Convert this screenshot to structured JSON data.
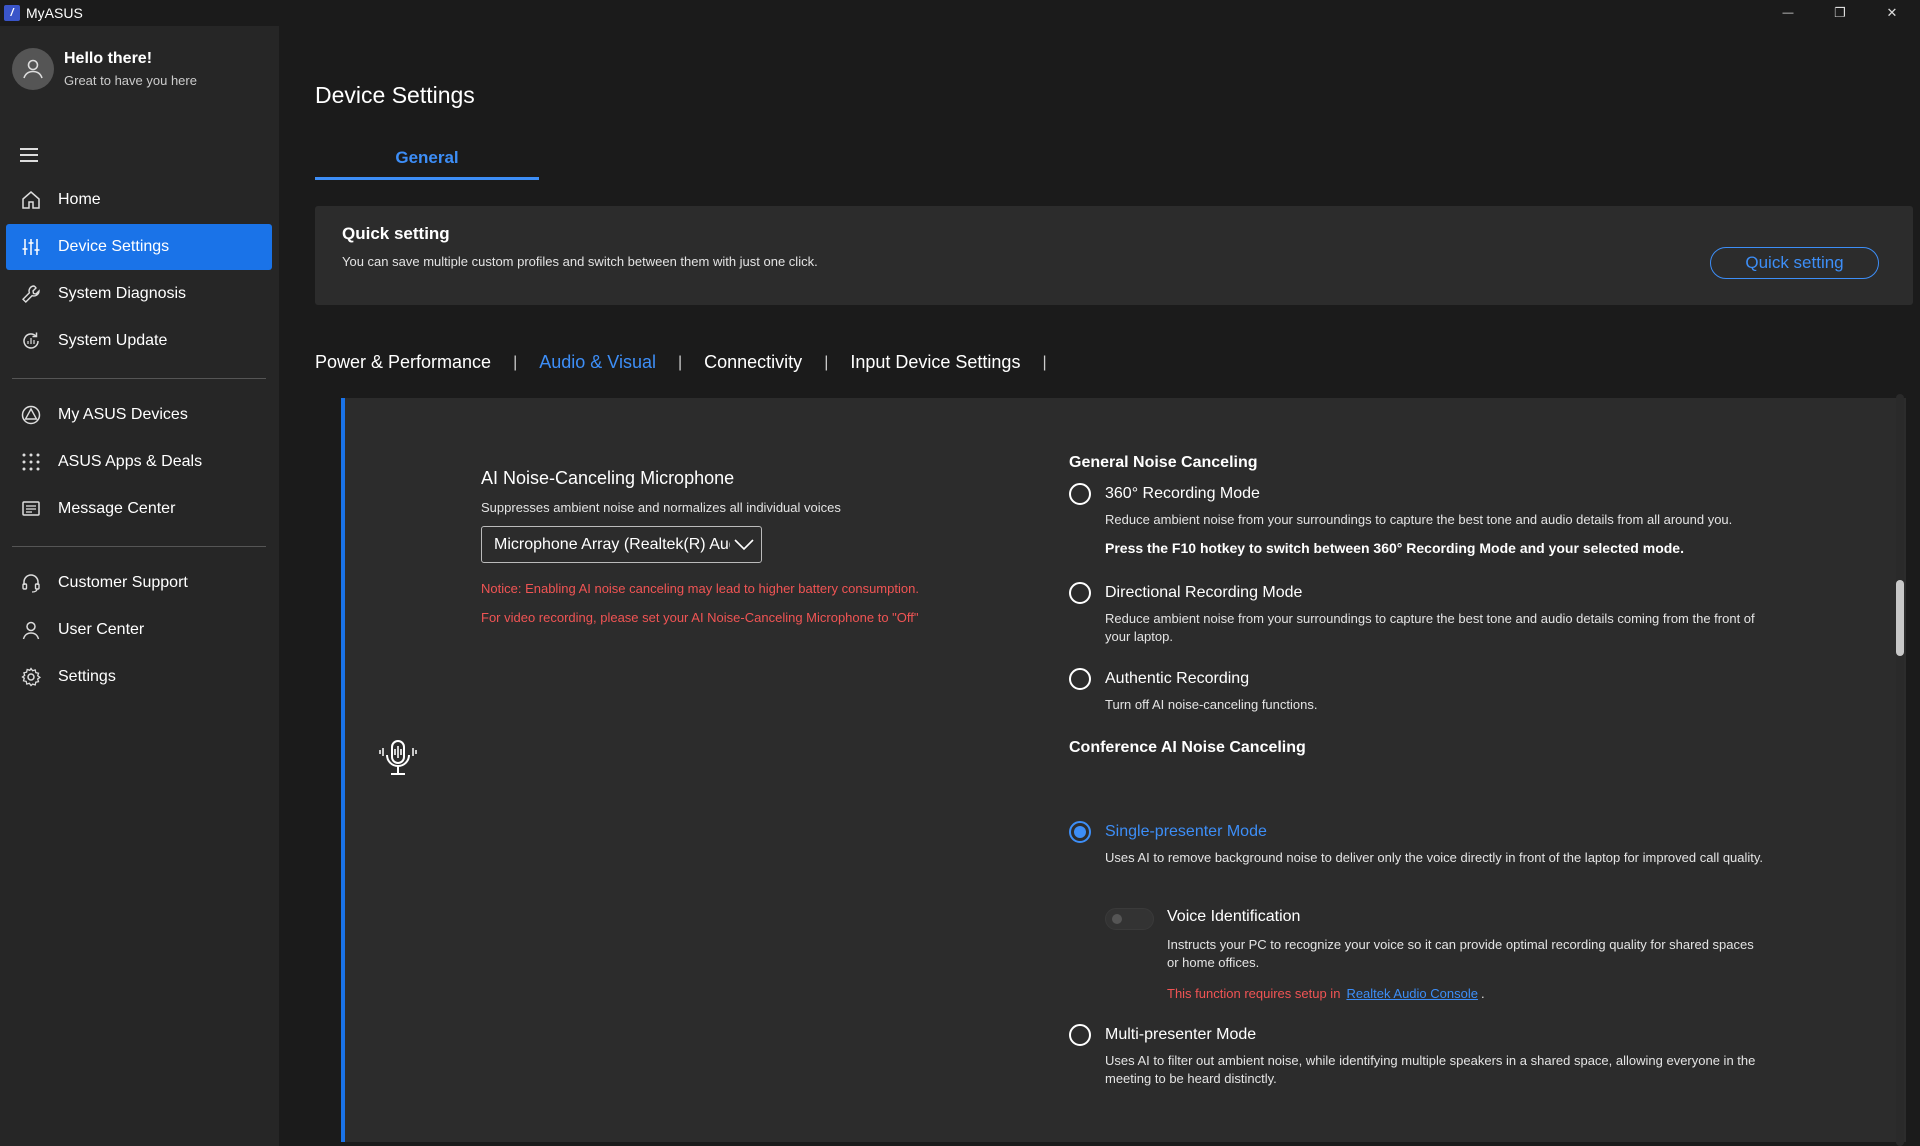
{
  "app": {
    "title": "MyASUS",
    "logo_text": "/"
  },
  "window_controls": {
    "minimize": "—",
    "restore": "❐",
    "close": "✕"
  },
  "user": {
    "greeting": "Hello there!",
    "subtitle": "Great to have you here"
  },
  "sidebar": {
    "items": [
      {
        "label": "Home",
        "icon": "home-icon"
      },
      {
        "label": "Device Settings",
        "icon": "sliders-icon",
        "active": true
      },
      {
        "label": "System Diagnosis",
        "icon": "wrench-icon"
      },
      {
        "label": "System Update",
        "icon": "update-icon"
      },
      {
        "label": "My ASUS Devices",
        "icon": "devices-icon"
      },
      {
        "label": "ASUS Apps & Deals",
        "icon": "apps-grid-icon"
      },
      {
        "label": "Message Center",
        "icon": "message-icon"
      },
      {
        "label": "Customer Support",
        "icon": "headset-icon"
      },
      {
        "label": "User Center",
        "icon": "user-icon"
      },
      {
        "label": "Settings",
        "icon": "gear-icon"
      }
    ]
  },
  "main": {
    "title": "Device Settings",
    "tab": "General",
    "quick_setting": {
      "title": "Quick setting",
      "description": "You can save multiple custom profiles and switch between them with just one click.",
      "button": "Quick setting"
    },
    "subtabs": [
      "Power & Performance",
      "Audio & Visual",
      "Connectivity",
      "Input Device Settings"
    ],
    "active_subtab": "Audio & Visual"
  },
  "mic": {
    "title": "AI Noise-Canceling Microphone",
    "description": "Suppresses ambient noise and normalizes all individual voices",
    "device_selected": "Microphone Array (Realtek(R) Audio)",
    "notice1": "Notice: Enabling AI noise canceling may lead to higher battery consumption.",
    "notice2": "For video recording, please set your AI Noise-Canceling Microphone to \"Off\""
  },
  "general_nc": {
    "heading": "General Noise Canceling",
    "opt360": {
      "label": "360° Recording Mode",
      "desc": "Reduce ambient noise from your surroundings to capture the best tone and audio details from all around you.",
      "hint": "Press the F10 hotkey to switch between 360° Recording Mode and your selected mode."
    },
    "directional": {
      "label": "Directional Recording Mode",
      "desc": "Reduce ambient noise from your surroundings to capture the best tone and audio details coming from the front of your laptop."
    },
    "authentic": {
      "label": "Authentic Recording",
      "desc": "Turn off AI noise-canceling functions."
    }
  },
  "conference_nc": {
    "heading": "Conference AI Noise Canceling",
    "single": {
      "label": "Single-presenter Mode",
      "desc": "Uses AI to remove background noise to deliver only the voice directly in front of the laptop for improved call quality.",
      "selected": true
    },
    "voice_id": {
      "label": "Voice Identification",
      "desc": "Instructs your PC to recognize your voice so it can provide optimal recording quality for shared spaces or home offices.",
      "requirement": "This function requires setup in",
      "link": "Realtek Audio Console",
      "after": ".",
      "enabled": false
    },
    "multi": {
      "label": "Multi-presenter Mode",
      "desc": "Uses AI to filter out ambient noise, while identifying multiple speakers in a shared space, allowing everyone in the meeting to be heard distinctly."
    }
  }
}
